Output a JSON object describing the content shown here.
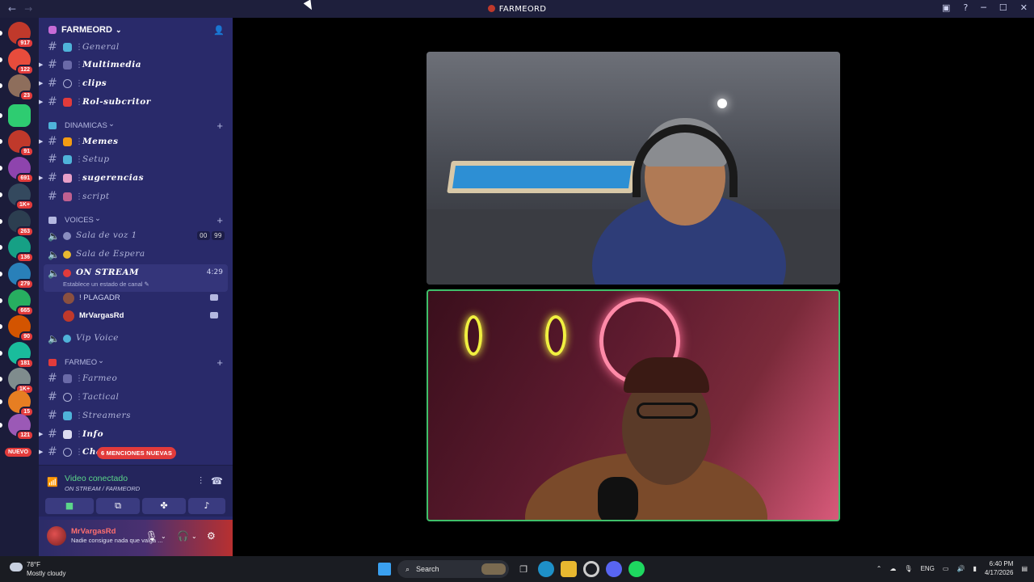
{
  "window": {
    "title": "FARMEORD"
  },
  "guilds": [
    {
      "badge": "917",
      "color": "#c0392b"
    },
    {
      "badge": "122",
      "color": "#e74c3c"
    },
    {
      "badge": "23",
      "color": "#8e6e5c"
    },
    {
      "badge": "",
      "color": "#2ecc71"
    },
    {
      "badge": "91",
      "color": "#c0392b"
    },
    {
      "badge": "691",
      "color": "#8e44ad"
    },
    {
      "badge": "1K+",
      "color": "#34495e"
    },
    {
      "badge": "263",
      "color": "#2c3e50"
    },
    {
      "badge": "136",
      "color": "#16a085"
    },
    {
      "badge": "279",
      "color": "#2980b9"
    },
    {
      "badge": "665",
      "color": "#27ae60"
    },
    {
      "badge": "90",
      "color": "#d35400"
    },
    {
      "badge": "181",
      "color": "#1abc9c"
    },
    {
      "badge": "1K+",
      "color": "#7f8c8d"
    },
    {
      "badge": "15",
      "color": "#e67e22"
    },
    {
      "badge": "121",
      "color": "#9b59b6"
    }
  ],
  "guild_new_label": "NUEVO",
  "server": {
    "name": "FARMEORD"
  },
  "channels_top": [
    {
      "name": "General",
      "unread": false,
      "emoji_color": "#4fb3d9"
    },
    {
      "name": "Multimedia",
      "unread": true,
      "emoji_color": "#6a6aa8"
    },
    {
      "name": "clips",
      "unread": true,
      "emoji_color": ""
    },
    {
      "name": "Rol-subcritor",
      "unread": true,
      "emoji_color": "#e23b3b"
    }
  ],
  "categories": {
    "dinamicas": "DINAMICAS",
    "voices": "VOICES",
    "farmeo": "FARMEO"
  },
  "channels_dinamicas": [
    {
      "name": "Memes",
      "unread": true,
      "emoji_color": "#f39c12"
    },
    {
      "name": "Setup",
      "unread": false,
      "emoji_color": "#4fb3d9"
    },
    {
      "name": "sugerencias",
      "unread": true,
      "emoji_color": "#e8a0c8"
    },
    {
      "name": "script",
      "unread": false,
      "emoji_color": "#c06090"
    }
  ],
  "voice_channels": [
    {
      "name": "Sala de voz 1",
      "counts": [
        "00",
        "99"
      ]
    },
    {
      "name": "Sala de Espera"
    }
  ],
  "active_voice": {
    "name": "ON STREAM",
    "timer": "4:29",
    "status_placeholder": "Establece un estado de canal"
  },
  "members": [
    {
      "name": "! PLAGADR",
      "color": "#8a5040"
    },
    {
      "name": "MrVargasRd",
      "color": "#c0392b"
    }
  ],
  "vip_voice": "Vip Voice",
  "channels_farmeo": [
    {
      "name": "Farmeo",
      "unread": false,
      "emoji_color": "#6a6aa8"
    },
    {
      "name": "Tactical",
      "unread": false,
      "emoji_color": ""
    },
    {
      "name": "Streamers",
      "unread": false,
      "emoji_color": "#4fb3d9"
    },
    {
      "name": "Info",
      "unread": true,
      "emoji_color": "#dcdcf0"
    },
    {
      "name": "Chat",
      "unread": true,
      "emoji_color": ""
    }
  ],
  "mentions_label": "6 MENCIONES NUEVAS",
  "voice_panel": {
    "title": "Video conectado",
    "subtitle": "ON STREAM / FARMEORD"
  },
  "user": {
    "name": "MrVargasRd",
    "status": "Nadie consigue nada que valga ..."
  },
  "taskbar": {
    "temp": "78°F",
    "weather": "Mostly cloudy",
    "search_placeholder": "Search",
    "lang": "ENG",
    "time": "6:40 PM",
    "date": "4/17/2026"
  }
}
